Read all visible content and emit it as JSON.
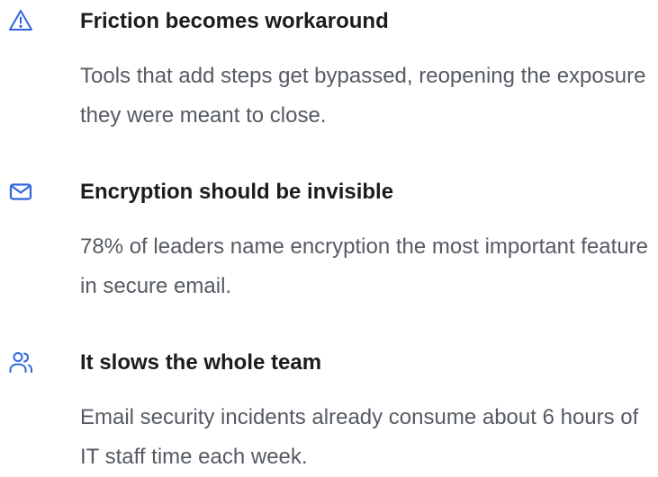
{
  "colors": {
    "accent": "#2f66dd",
    "title": "#1c1c1e",
    "body": "#555a63"
  },
  "items": [
    {
      "icon": "warning-triangle-icon",
      "title": "Friction becomes workaround",
      "description": "Tools that add steps get bypassed, reopening the exposure they were meant to close."
    },
    {
      "icon": "mail-icon",
      "title": "Encryption should be invisible",
      "description": "78% of leaders name encryption the most important feature in secure email."
    },
    {
      "icon": "users-icon",
      "title": "It slows the whole team",
      "description": "Email security incidents already consume about 6 hours of IT staff time each week."
    }
  ]
}
